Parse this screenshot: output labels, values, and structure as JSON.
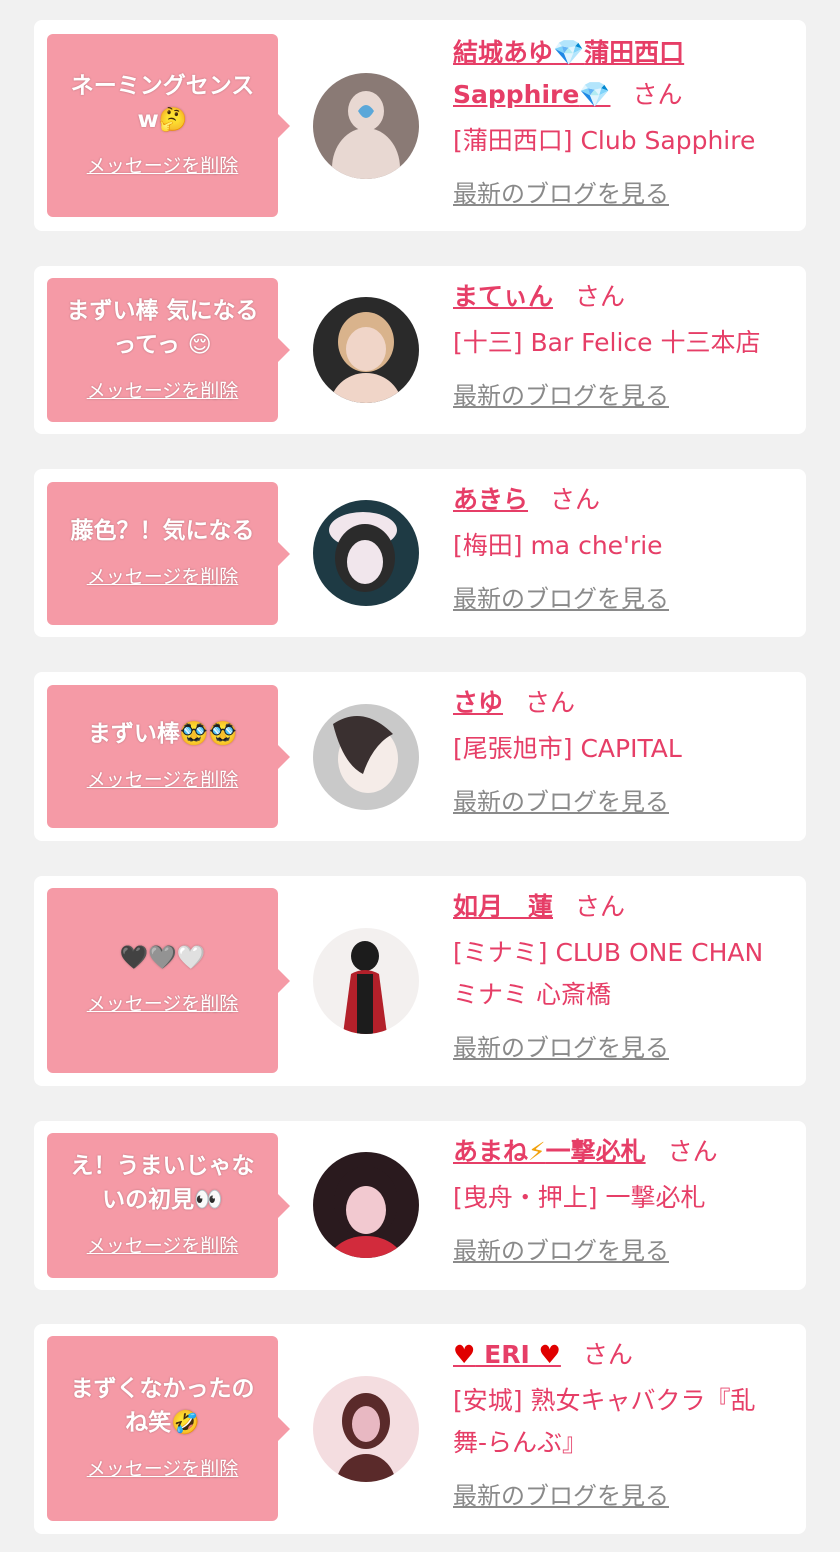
{
  "labels": {
    "delete": "メッセージを削除",
    "blog": "最新のブログを見る",
    "san": "さん"
  },
  "items": [
    {
      "message_lines": [
        "ネーミングセンス",
        "w🤔"
      ],
      "name_parts": [
        "結城あゆ",
        "💎",
        "蒲田西口",
        "Sapphire",
        "💎"
      ],
      "shop": "[蒲田西口] Club Sapphire",
      "avatar_colors": [
        "#8a7a75",
        "#e8d8d2",
        "#5aa7d9"
      ]
    },
    {
      "message_lines": [
        "まずい棒 気になる",
        "ってっ 😌"
      ],
      "name": "まてぃん",
      "shop": "[十三] Bar Felice 十三本店",
      "avatar_colors": [
        "#2a2a2a",
        "#d9b38c",
        "#f0d5c8"
      ]
    },
    {
      "message_lines": [
        "藤色？！気になる"
      ],
      "name": "あきら",
      "shop": "[梅田] ma che'rie",
      "avatar_colors": [
        "#1e3a44",
        "#f1e6ec",
        "#2b2b2b"
      ]
    },
    {
      "message_lines": [
        "まずい棒🥸🥸"
      ],
      "name": "さゆ",
      "shop": "[尾張旭市] CAPITAL",
      "avatar_colors": [
        "#c9c9c9",
        "#f5ece8",
        "#3a3030"
      ]
    },
    {
      "message_lines": [
        "🖤🩶🤍"
      ],
      "name": "如月　蓮",
      "shop_lines": [
        "[ミナミ] CLUB ONE CHAN",
        "ミナミ 心斎橋"
      ],
      "avatar_colors": [
        "#f3f0ef",
        "#b3202a",
        "#1c1c1c"
      ]
    },
    {
      "message_lines": [
        "え！うまいじゃな",
        "いの初見👀"
      ],
      "name_parts": [
        "あまね",
        "⚡",
        "一撃必札"
      ],
      "shop": "[曳舟・押上] 一撃必札",
      "avatar_colors": [
        "#2a1a1e",
        "#f2c9d0",
        "#d22b3c"
      ]
    },
    {
      "message_lines": [
        "まずくなかったの",
        "ね笑🤣"
      ],
      "name_parts": [
        "♥",
        " ERI ",
        "♥"
      ],
      "shop_lines": [
        "[安城] 熟女キャバクラ『乱",
        "舞-らんぶ』"
      ],
      "avatar_colors": [
        "#f4dde0",
        "#e8b8c2",
        "#5a2a2a"
      ]
    }
  ]
}
